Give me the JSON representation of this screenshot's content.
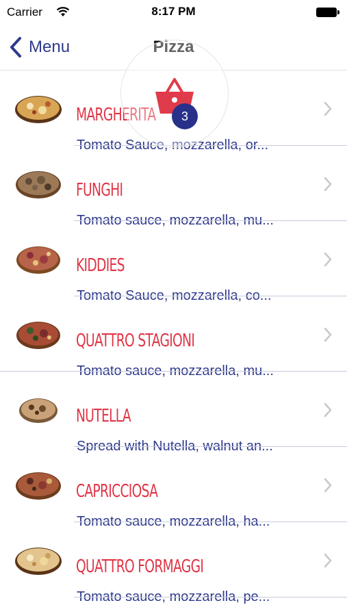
{
  "status_bar": {
    "carrier": "Carrier",
    "time": "8:17 PM"
  },
  "nav": {
    "back_label": "Menu",
    "title": "Pizza"
  },
  "cart": {
    "count": "3"
  },
  "colors": {
    "accent_blue": "#2e3a8c",
    "title_red": "#e03546",
    "cart_red": "#e03b4a",
    "badge_blue": "#27318a"
  },
  "pizzas": [
    {
      "name": "MARGHERITA",
      "description": "Tomato Sauce, mozzarella, or..."
    },
    {
      "name": "FUNGHI",
      "description": "Tomato sauce, mozzarella, mu..."
    },
    {
      "name": "KIDDIES",
      "description": "Tomato Sauce, mozzarella, co..."
    },
    {
      "name": "QUATTRO STAGIONI",
      "description": "Tomato sauce, mozzarella, mu..."
    },
    {
      "name": "NUTELLA",
      "description": "Spread with Nutella, walnut an..."
    },
    {
      "name": "CAPRICCIOSA",
      "description": "Tomato sauce, mozzarella, ha..."
    },
    {
      "name": "QUATTRO FORMAGGI",
      "description": "Tomato sauce, mozzarella, pe..."
    }
  ]
}
